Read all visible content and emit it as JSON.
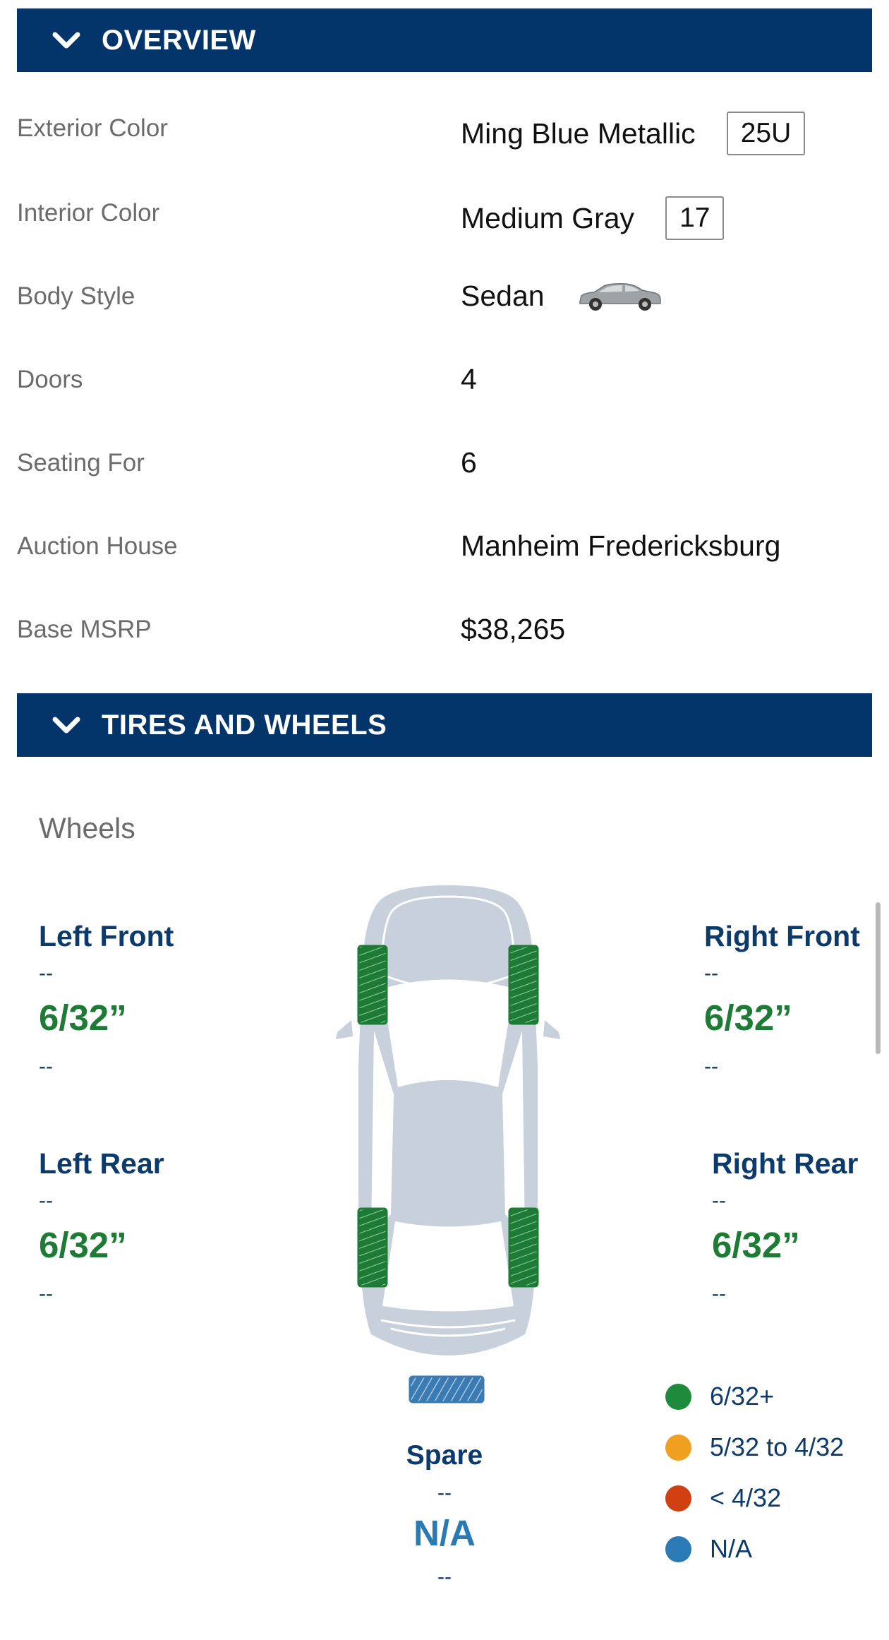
{
  "overview": {
    "title": "OVERVIEW",
    "rows": [
      {
        "label": "Exterior Color",
        "value": "Ming Blue Metallic",
        "code": "25U"
      },
      {
        "label": "Interior Color",
        "value": "Medium Gray",
        "code": "17"
      },
      {
        "label": "Body Style",
        "value": "Sedan",
        "icon": "sedan-car-icon"
      },
      {
        "label": "Doors",
        "value": "4"
      },
      {
        "label": "Seating For",
        "value": "6"
      },
      {
        "label": "Auction House",
        "value": "Manheim Fredericksburg"
      },
      {
        "label": "Base MSRP",
        "value": "$38,265"
      }
    ]
  },
  "tires": {
    "title": "TIRES AND WHEELS",
    "wheels_label": "Wheels",
    "left_front": {
      "name": "Left Front",
      "line1": "--",
      "depth": "6/32”",
      "line2": "--"
    },
    "right_front": {
      "name": "Right Front",
      "line1": "--",
      "depth": "6/32”",
      "line2": "--"
    },
    "left_rear": {
      "name": "Left Rear",
      "line1": "--",
      "depth": "6/32”",
      "line2": "--"
    },
    "right_rear": {
      "name": "Right Rear",
      "line1": "--",
      "depth": "6/32”",
      "line2": "--"
    },
    "spare": {
      "name": "Spare",
      "line1": "--",
      "value": "N/A",
      "line2": "--"
    }
  },
  "legend": [
    {
      "label": "6/32+",
      "color": "#1e8a3c"
    },
    {
      "label": "5/32 to 4/32",
      "color": "#f0a020"
    },
    {
      "label": "< 4/32",
      "color": "#d04010"
    },
    {
      "label": "N/A",
      "color": "#2a7ab5"
    }
  ],
  "colors": {
    "header_bg": "#03356a",
    "tire_good": "#1e7b36",
    "car_body": "#c8d0dc",
    "navy_text": "#0b3a6b"
  }
}
